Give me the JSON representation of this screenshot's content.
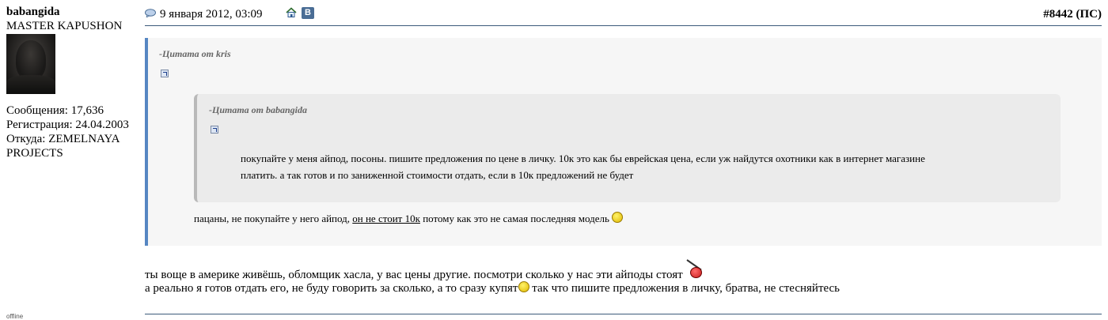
{
  "user": {
    "name": "babangida",
    "title": "MASTER KAPUSHON",
    "posts": "Сообщения: 17,636",
    "registered": "Регистрация: 24.04.2003",
    "from_line1": "Откуда: ZEMELNAYA",
    "from_line2": "PROJECTS",
    "status": "offline"
  },
  "post": {
    "date": "9 января 2012, 03:09",
    "vk_label": "В",
    "number": "#8442",
    "number_suffix": " (ПС)"
  },
  "quote_outer": {
    "author": "-Цитата от kris"
  },
  "quote_inner": {
    "author": "-Цитата от babangida",
    "line1": "покупайте у меня айпод, посоны. пишите предложения по цене в личку. 10к это как бы еврейская цена, если уж найдутся охотники как в интернет магазине",
    "line2": "платить. а так готов и по заниженной стоимости отдать, если в 10к предложений не будет"
  },
  "reply": {
    "before": "пацаны, не покупайте у него айпод, ",
    "underlined": "он не стоит 10к",
    "after": " потому как это не самая последняя модель"
  },
  "body": {
    "line1": "ты воще в америке живёшь, обломщик хасла, у вас цены другие. посмотри сколько у нас эти айподы стоят",
    "line2_a": "а реально я готов отдать его, не буду говорить за сколько, а то сразу купят",
    "line2_b": " так что пишите предложения в личку, братва, не стесняйтесь"
  },
  "colors": {
    "quote_border": "#5686c2",
    "rule": "#3b5a7a",
    "vk_blue": "#4a6d95"
  }
}
